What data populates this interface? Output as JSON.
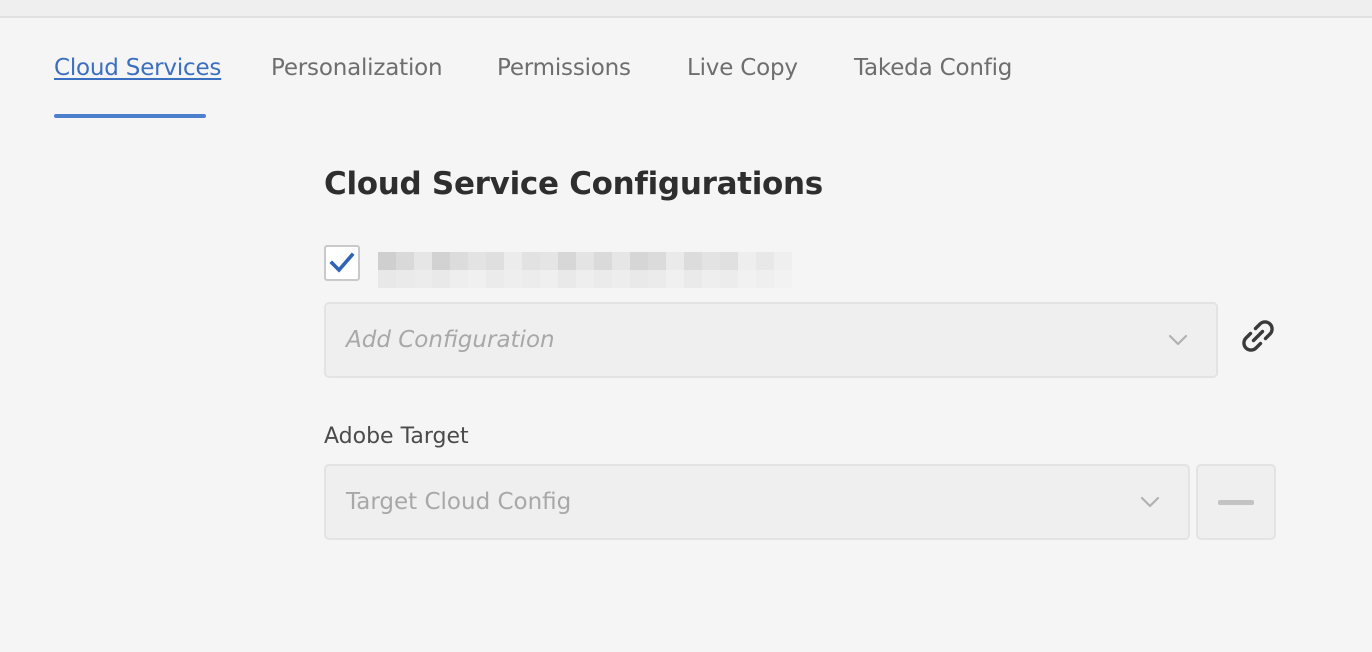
{
  "tabs": [
    {
      "label": "Cloud Services",
      "active": true
    },
    {
      "label": "Personalization",
      "active": false
    },
    {
      "label": "Permissions",
      "active": false
    },
    {
      "label": "Live Copy",
      "active": false
    },
    {
      "label": "Takeda Config",
      "active": false
    }
  ],
  "section": {
    "title": "Cloud Service Configurations"
  },
  "inherit": {
    "checked": true,
    "label_redacted": true
  },
  "add_configuration": {
    "placeholder": "Add Configuration",
    "dropdown_icon": "chevron-down-icon",
    "action_icon": "link-icon"
  },
  "adobe_target": {
    "label": "Adobe Target",
    "value": "Target Cloud Config",
    "dropdown_icon": "chevron-down-icon",
    "remove_icon": "minus-icon"
  },
  "colors": {
    "accent": "#3b6fbf",
    "checkmark": "#2f63b8",
    "background": "#f5f5f5"
  }
}
